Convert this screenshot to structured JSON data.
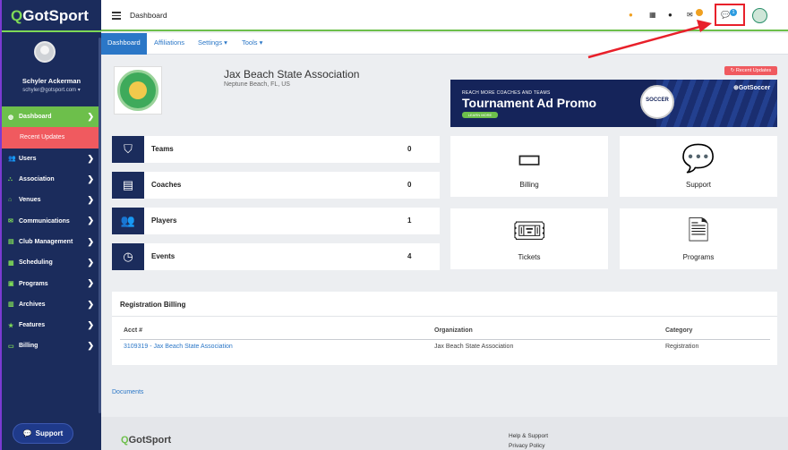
{
  "app": {
    "logo_text": "GotSport",
    "logo_mark": "Q"
  },
  "user": {
    "name": "Schyler Ackerman",
    "email": "schyler@gotsport.com ▾"
  },
  "sidebar": {
    "items": [
      {
        "label": "Dashboard",
        "icon": "dashboard-icon",
        "glyph": "◍",
        "chevron": "❯"
      },
      {
        "label": "Recent Updates",
        "icon": "",
        "glyph": "",
        "chevron": ""
      },
      {
        "label": "Users",
        "icon": "users-icon",
        "glyph": "👥",
        "chevron": "❯"
      },
      {
        "label": "Association",
        "icon": "association-icon",
        "glyph": "⛬",
        "chevron": "❯"
      },
      {
        "label": "Venues",
        "icon": "venues-icon",
        "glyph": "⌂",
        "chevron": "❯"
      },
      {
        "label": "Communications",
        "icon": "communications-icon",
        "glyph": "✉",
        "chevron": "❯"
      },
      {
        "label": "Club Management",
        "icon": "club-management-icon",
        "glyph": "▤",
        "chevron": "❯"
      },
      {
        "label": "Scheduling",
        "icon": "scheduling-icon",
        "glyph": "▦",
        "chevron": "❯"
      },
      {
        "label": "Programs",
        "icon": "programs-icon",
        "glyph": "▣",
        "chevron": "❯"
      },
      {
        "label": "Archives",
        "icon": "archives-icon",
        "glyph": "▥",
        "chevron": "❯"
      },
      {
        "label": "Features",
        "icon": "features-icon",
        "glyph": "★",
        "chevron": "❯"
      },
      {
        "label": "Billing",
        "icon": "billing-icon",
        "glyph": "▭",
        "chevron": "❯"
      }
    ],
    "support_label": "Support"
  },
  "topbar": {
    "title": "Dashboard",
    "icons": [
      "help-icon",
      "qr-icon",
      "user-icon",
      "mail-icon",
      "chat-icon"
    ],
    "mail_badge": "",
    "chat_badge": "1"
  },
  "tabs": [
    {
      "label": "Dashboard",
      "active": true
    },
    {
      "label": "Affiliations",
      "active": false
    },
    {
      "label": "Settings ▾",
      "active": false
    },
    {
      "label": "Tools ▾",
      "active": false
    }
  ],
  "org": {
    "name": "Jax Beach State Association",
    "location": "Neptune Beach, FL, US"
  },
  "recent_updates_button": "↻ Recent Updates",
  "promo": {
    "small_text": "REACH MORE COACHES AND TEAMS",
    "title": "Tournament Ad Promo",
    "cta": "LEARN MORE",
    "badge": "SOCCER",
    "brand": "⊕GotSoccer"
  },
  "stats": [
    {
      "label": "Teams",
      "value": "0",
      "icon": "shield-icon",
      "glyph": "⛉"
    },
    {
      "label": "Coaches",
      "value": "0",
      "icon": "clipboard-icon",
      "glyph": "▤"
    },
    {
      "label": "Players",
      "value": "1",
      "icon": "players-icon",
      "glyph": "👥"
    },
    {
      "label": "Events",
      "value": "4",
      "icon": "clock-icon",
      "glyph": "◷"
    }
  ],
  "tiles": [
    {
      "label": "Billing",
      "icon": "credit-card-icon",
      "glyph": "▭"
    },
    {
      "label": "Support",
      "icon": "chat-bubbles-icon",
      "glyph": "💬"
    },
    {
      "label": "Tickets",
      "icon": "ticket-icon",
      "glyph": "🎟"
    },
    {
      "label": "Programs",
      "icon": "document-icon",
      "glyph": "🗎"
    }
  ],
  "billing": {
    "title": "Registration Billing",
    "columns": [
      "Acct #",
      "Organization",
      "Category"
    ],
    "rows": [
      {
        "acct": "3109319 - Jax Beach State Association",
        "organization": "Jax Beach State Association",
        "category": "Registration"
      }
    ]
  },
  "documents_link": "Documents",
  "footer": {
    "logo": "GotSport",
    "links": [
      "Help & Support",
      "Privacy Policy"
    ]
  },
  "colors": {
    "sidebar": "#1b2c5c",
    "accent_green": "#6dbf4b",
    "accent_red": "#f05a5f",
    "link_blue": "#2b77c7"
  }
}
